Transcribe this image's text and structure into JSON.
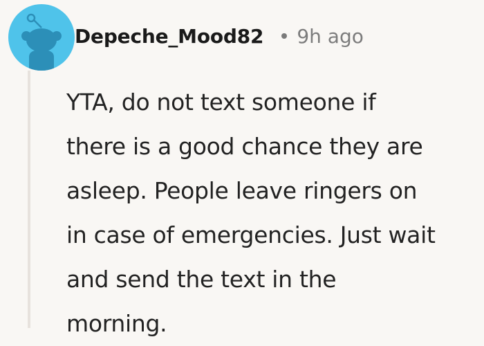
{
  "comment": {
    "author": "Depeche_Mood82",
    "separator": "•",
    "timestamp": "9h ago",
    "body_lines": [
      "YTA, do not text someone if",
      "there is a good chance they are",
      "asleep. People leave ringers on",
      "in case of emergencies. Just wait",
      "and send the text in the",
      "morning."
    ],
    "avatar": {
      "icon": "reddit-snoo-avatar-icon",
      "background_color": "#4fc3ea",
      "figure_color": "#2c8fb8"
    }
  },
  "colors": {
    "page_background": "#f9f7f4",
    "thread_line": "#e7e2dd",
    "text": "#222222",
    "muted": "#7c7c7c"
  }
}
